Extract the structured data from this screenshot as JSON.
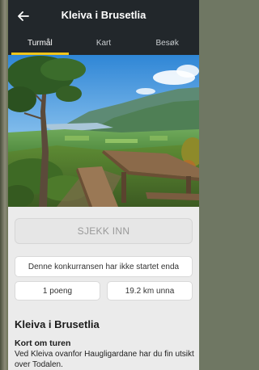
{
  "header": {
    "title": "Kleiva i Brusetlia",
    "back_icon": "arrow-left-icon",
    "tabs": [
      {
        "label": "Turmål",
        "active": true
      },
      {
        "label": "Kart",
        "active": false
      },
      {
        "label": "Besøk",
        "active": false
      }
    ]
  },
  "colors": {
    "header_bg": "#22272b",
    "tab_indicator": "#f0c419",
    "page_bg": "#ebebeb"
  },
  "main": {
    "checkin_label": "SJEKK INN",
    "notice": "Denne konkurransen har ikke startet enda",
    "points": "1 poeng",
    "distance": "19.2 km unna",
    "place_title": "Kleiva i Brusetlia",
    "section_heading": "Kort om turen",
    "description": "Ved Kleiva ovanfor Haugligardane har du fin utsikt over Todalen."
  }
}
